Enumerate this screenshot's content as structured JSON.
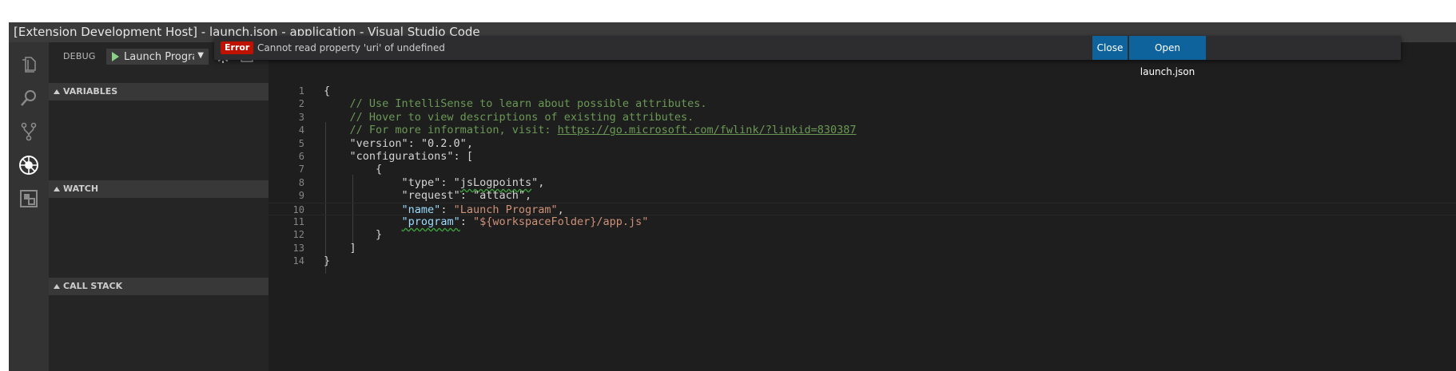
{
  "window": {
    "title": "[Extension Development Host] - launch.json - application - Visual Studio Code"
  },
  "activity_bar": {
    "icons": [
      "files-icon",
      "search-icon",
      "source-control-icon",
      "debug-icon",
      "extensions-icon"
    ]
  },
  "debug_toolbar": {
    "label": "DEBUG",
    "launch_config": "Launch Progra",
    "start_icon": "play-icon",
    "settings_icon": "gear-icon",
    "console_icon": "terminal-icon"
  },
  "sidebar": {
    "sections": [
      "VARIABLES",
      "WATCH",
      "CALL STACK"
    ]
  },
  "notification": {
    "severity": "Error",
    "message": "Cannot read property 'uri' of undefined",
    "close_label": "Close",
    "open_label": "Open launch.json"
  },
  "editor": {
    "file": "launch.json",
    "lines": [
      {
        "n": "1",
        "indent": "",
        "segs": [
          {
            "t": "{",
            "c": ""
          }
        ]
      },
      {
        "n": "2",
        "indent": "    ",
        "segs": [
          {
            "t": "// Use IntelliSense to learn about possible attributes.",
            "c": "c-comment"
          }
        ]
      },
      {
        "n": "3",
        "indent": "    ",
        "segs": [
          {
            "t": "// Hover to view descriptions of existing attributes.",
            "c": "c-comment"
          }
        ]
      },
      {
        "n": "4",
        "indent": "    ",
        "segs": [
          {
            "t": "// For more information, visit: ",
            "c": "c-comment"
          },
          {
            "t": "https://go.microsoft.com/fwlink/?linkid=830387",
            "c": "c-link"
          }
        ]
      },
      {
        "n": "5",
        "indent": "    ",
        "segs": [
          {
            "t": "\"version\": \"0.2.0\",",
            "c": ""
          }
        ]
      },
      {
        "n": "6",
        "indent": "    ",
        "segs": [
          {
            "t": "\"configurations\": [",
            "c": ""
          }
        ]
      },
      {
        "n": "7",
        "indent": "        ",
        "segs": [
          {
            "t": "{",
            "c": ""
          }
        ]
      },
      {
        "n": "8",
        "indent": "            ",
        "segs": [
          {
            "t": "\"type\": \"",
            "c": ""
          },
          {
            "t": "jsLogpoints",
            "c": "squiggle"
          },
          {
            "t": "\",",
            "c": ""
          }
        ]
      },
      {
        "n": "9",
        "indent": "            ",
        "segs": [
          {
            "t": "\"request\": \"attach\",",
            "c": ""
          }
        ]
      },
      {
        "n": "10",
        "indent": "            ",
        "segs": [
          {
            "t": "\"name\"",
            "c": "c-key"
          },
          {
            "t": ": ",
            "c": ""
          },
          {
            "t": "\"Launch Program\"",
            "c": "c-str"
          },
          {
            "t": ",",
            "c": ""
          }
        ]
      },
      {
        "n": "11",
        "indent": "            ",
        "segs": [
          {
            "t": "\"program\"",
            "c": "c-key squiggle"
          },
          {
            "t": ": ",
            "c": ""
          },
          {
            "t": "\"${workspaceFolder}/app.js\"",
            "c": "c-str"
          }
        ]
      },
      {
        "n": "12",
        "indent": "        ",
        "segs": [
          {
            "t": "}",
            "c": ""
          }
        ]
      },
      {
        "n": "13",
        "indent": "    ",
        "segs": [
          {
            "t": "]",
            "c": ""
          }
        ]
      },
      {
        "n": "14",
        "indent": "",
        "segs": [
          {
            "t": "}",
            "c": ""
          }
        ]
      }
    ],
    "current_line": "10"
  },
  "colors": {
    "accent_button": "#0e639c",
    "error_badge": "#be1100",
    "comment": "#6a9955",
    "string": "#ce9178",
    "property": "#9cdcfe",
    "play": "#89d185"
  }
}
